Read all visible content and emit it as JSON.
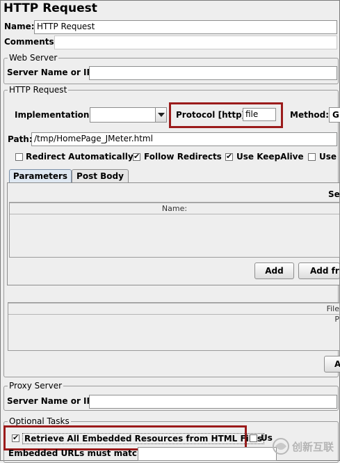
{
  "title": "HTTP Request",
  "name": {
    "label": "Name:",
    "value": "HTTP Request"
  },
  "comments": {
    "label": "Comments:"
  },
  "web_server": {
    "group_title": "Web Server",
    "server_label": "Server Name or IP:",
    "server_value": ""
  },
  "http_request": {
    "group_title": "HTTP Request",
    "implementation_label": "Implementation:",
    "implementation_value": "",
    "protocol_label": "Protocol [http]:",
    "protocol_value": "file",
    "method_label": "Method:",
    "method_value": "G",
    "path_label": "Path:",
    "path_value": "/tmp/HomePage_JMeter.html",
    "checkboxes": [
      {
        "label": "Redirect Automatically",
        "checked": false
      },
      {
        "label": "Follow Redirects",
        "checked": true
      },
      {
        "label": "Use KeepAlive",
        "checked": true
      },
      {
        "label": "Use m",
        "checked": false
      }
    ],
    "tabs": [
      "Parameters",
      "Post Body"
    ],
    "params_header_right": "Se",
    "params_column": "Name:",
    "add_button": "Add",
    "add_from_button": "Add fro",
    "files_column": "File P",
    "files_button": "A"
  },
  "proxy": {
    "group_title": "Proxy Server",
    "server_label": "Server Name or IP:",
    "server_value": ""
  },
  "optional": {
    "group_title": "Optional Tasks",
    "retrieve_label": "Retrieve All Embedded Resources from HTML Files",
    "retrieve_checked": true,
    "use_label": "Us",
    "embedded_label": "Embedded URLs must match:",
    "embedded_value": ""
  },
  "watermark_text": "创新互联",
  "colors": {
    "highlight": "#9b1b1b",
    "background": "#eeeeee"
  }
}
